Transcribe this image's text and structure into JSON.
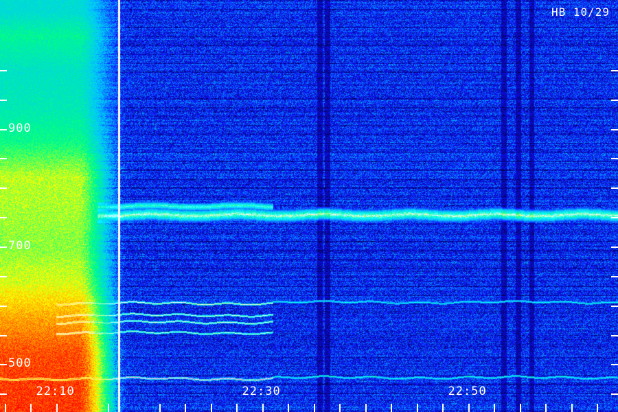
{
  "annotation": "HB 10/29",
  "chart_data": {
    "type": "heatmap",
    "title": "",
    "xlabel": "",
    "ylabel": "",
    "x_tick_labels": [
      "22:10",
      "22:30",
      "22:50"
    ],
    "x_tick_label_minutes": [
      10,
      30,
      50
    ],
    "x_range_minutes": [
      4.5,
      64.5
    ],
    "x_minor_tick_minutes": [
      5,
      7.5,
      10,
      15,
      20,
      22.5,
      25,
      27.5,
      30,
      32.5,
      35,
      37.5,
      40,
      42.5,
      45,
      47.5,
      50,
      52.5,
      55,
      57.5,
      60,
      62.5
    ],
    "y_tick_labels": [
      "500",
      "700",
      "900"
    ],
    "y_tick_values": [
      500,
      700,
      900
    ],
    "y_minor_ticks": [
      450,
      550,
      600,
      650,
      750,
      800,
      850,
      950,
      1000
    ],
    "y_range": [
      420,
      1120
    ],
    "marker_time_minute": 16,
    "colormap": [
      "#000040",
      "#1010ff",
      "#00c8ff",
      "#00ff80",
      "#ffff00",
      "#ff8000",
      "#ff0000"
    ],
    "background_noise_level": 0.18,
    "auroral_hiss": {
      "end_minute": 14.5,
      "profile": [
        {
          "freq": 460,
          "intensity": 0.95
        },
        {
          "freq": 520,
          "intensity": 0.92
        },
        {
          "freq": 580,
          "intensity": 0.8
        },
        {
          "freq": 640,
          "intensity": 0.66
        },
        {
          "freq": 700,
          "intensity": 0.6
        },
        {
          "freq": 760,
          "intensity": 0.62
        },
        {
          "freq": 820,
          "intensity": 0.64
        },
        {
          "freq": 880,
          "intensity": 0.5
        },
        {
          "freq": 940,
          "intensity": 0.44
        },
        {
          "freq": 1000,
          "intensity": 0.42
        },
        {
          "freq": 1060,
          "intensity": 0.48
        },
        {
          "freq": 1100,
          "intensity": 0.4
        }
      ]
    },
    "emission_bands": [
      {
        "freq": 755,
        "start_minute": 14,
        "end_minute": 64.5,
        "intensity": 0.55,
        "width": 10
      },
      {
        "freq": 770,
        "start_minute": 14,
        "end_minute": 31,
        "intensity": 0.45,
        "width": 6
      }
    ],
    "emission_lines": [
      {
        "freq": 605,
        "start_minute": 10,
        "end_minute": 31,
        "intensity": 0.72
      },
      {
        "freq": 607,
        "start_minute": 31,
        "end_minute": 64.5,
        "intensity": 0.48
      },
      {
        "freq": 585,
        "start_minute": 10,
        "end_minute": 31,
        "intensity": 0.66
      },
      {
        "freq": 573,
        "start_minute": 10,
        "end_minute": 31,
        "intensity": 0.68
      },
      {
        "freq": 555,
        "start_minute": 10,
        "end_minute": 31,
        "intensity": 0.64
      },
      {
        "freq": 477,
        "start_minute": 3,
        "end_minute": 31,
        "intensity": 0.85
      },
      {
        "freq": 479,
        "start_minute": 31,
        "end_minute": 64.5,
        "intensity": 0.5
      }
    ],
    "dark_vertical_bands_minutes": [
      35.5,
      36.3,
      53.4,
      54.8,
      56.1
    ]
  }
}
